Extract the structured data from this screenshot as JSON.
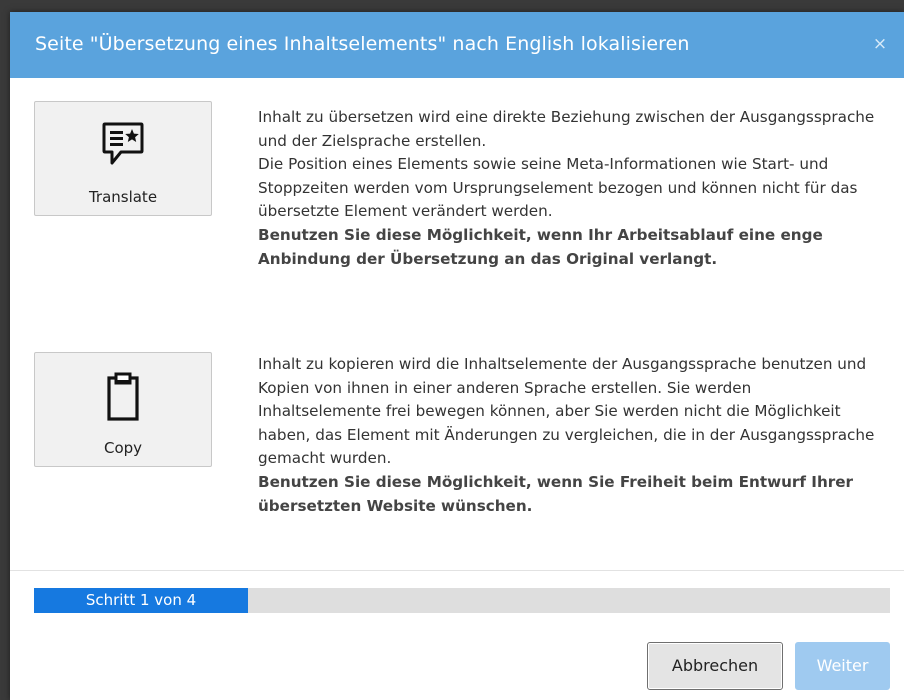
{
  "dialog": {
    "title": "Seite \"Übersetzung eines Inhaltselements\" nach English lokalisieren",
    "close_symbol": "×"
  },
  "options": [
    {
      "label": "Translate",
      "icon": "chat-star-icon",
      "description": [
        "Inhalt zu übersetzen wird eine direkte Beziehung zwischen der Ausgangssprache und der Zielsprache erstellen.",
        "Die Position eines Elements sowie seine Meta-Informationen wie Start- und Stoppzeiten werden vom Ursprungselement bezogen und können nicht für das übersetzte Element verändert werden."
      ],
      "emphasis": "Benutzen Sie diese Möglichkeit, wenn Ihr Arbeitsablauf eine enge Anbindung der Übersetzung an das Original verlangt."
    },
    {
      "label": "Copy",
      "icon": "clipboard-icon",
      "description": [
        "Inhalt zu kopieren wird die Inhaltselemente der Ausgangssprache benutzen und Kopien von ihnen in einer anderen Sprache erstellen. Sie werden Inhaltselemente frei bewegen können, aber Sie werden nicht die Möglichkeit haben, das Element mit Änderungen zu vergleichen, die in der Ausgangssprache gemacht wurden."
      ],
      "emphasis": "Benutzen Sie diese Möglichkeit, wenn Sie Freiheit beim Entwurf Ihrer übersetzten Website wünschen."
    }
  ],
  "progress": {
    "text": "Schritt 1 von 4",
    "current_step": 1,
    "total_steps": 4,
    "fill_fraction": 0.25
  },
  "buttons": {
    "cancel": "Abbrechen",
    "next": "Weiter"
  },
  "colors": {
    "header": "#5aa3dd",
    "progress_fill": "#1679e0",
    "progress_track": "#dedede",
    "next_disabled": "#9fcaf0"
  }
}
